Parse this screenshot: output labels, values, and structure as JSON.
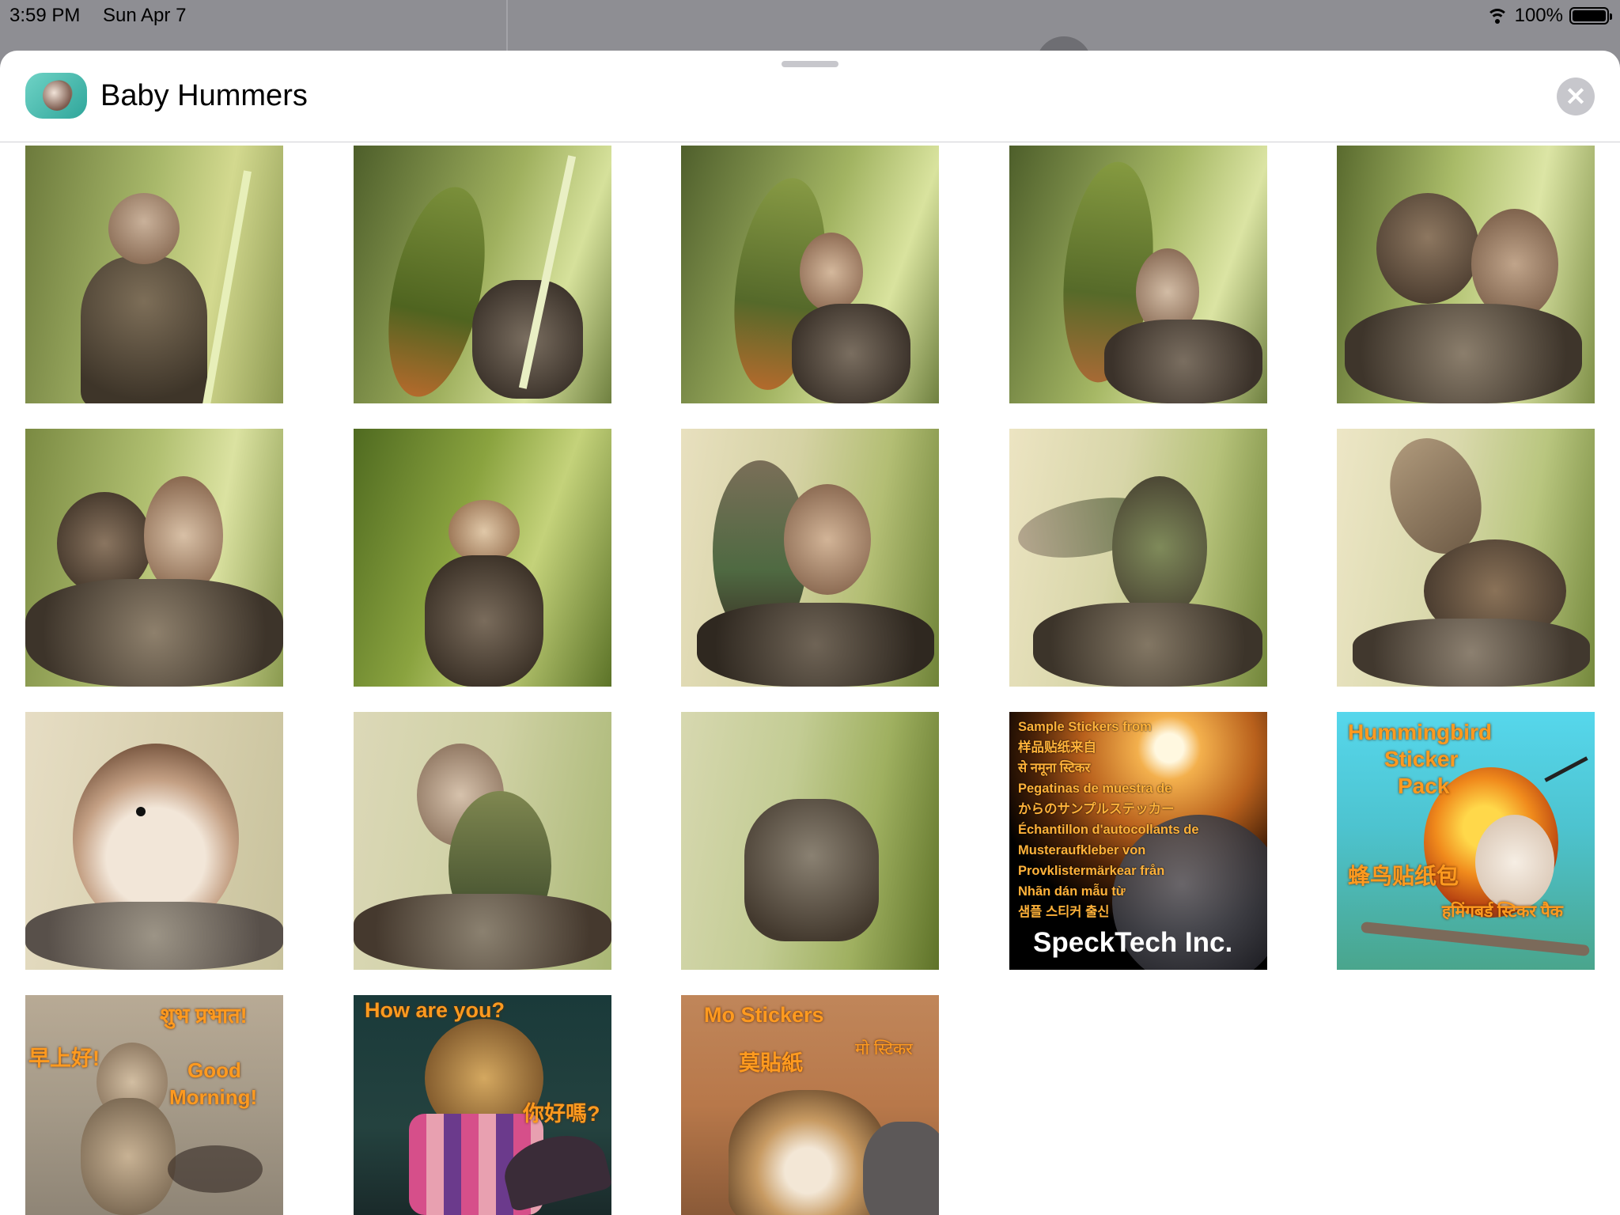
{
  "status_bar": {
    "time": "3:59 PM",
    "date": "Sun Apr 7",
    "battery": "100%"
  },
  "header": {
    "title": "Baby Hummers"
  },
  "colors": {
    "sheet_bg": "#ffffff",
    "status_bg": "#8e8e93",
    "close_bg": "#c7c7cc",
    "sticker_text": "#ff9a1f"
  },
  "stickers": [
    {
      "label": "hummingbird-nestling-photo"
    },
    {
      "label": "hummingbird-feeding-photo"
    },
    {
      "label": "hummingbird-feeding-photo"
    },
    {
      "label": "hummingbird-feeding-photo"
    },
    {
      "label": "hummingbird-nestlings-photo"
    },
    {
      "label": "hummingbird-nestlings-photo"
    },
    {
      "label": "hummingbird-nest-photo"
    },
    {
      "label": "hummingbird-fledglings-photo"
    },
    {
      "label": "hummingbird-wings-photo"
    },
    {
      "label": "hummingbird-wings-photo"
    },
    {
      "label": "hummingbird-closeup-photo"
    },
    {
      "label": "hummingbird-closeup-photo"
    },
    {
      "label": "empty-nest-photo"
    }
  ],
  "specktech_sticker": {
    "lines": [
      "Sample Stickers from",
      "样品贴纸来自",
      "से नमूना स्टिकर",
      "Pegatinas de muestra de",
      "からのサンプルステッカー",
      "Échantillon d'autocollants de",
      "Musteraufkleber von",
      "Provklistermärkear från",
      "Nhãn dán mẫu từ",
      "샘플 스티커 출신"
    ],
    "brand": "SpeckTech Inc."
  },
  "pack_sticker": {
    "line1": "Hummingbird",
    "line2": "Sticker",
    "line3": "Pack",
    "chinese": "蜂鸟贴纸包",
    "hindi": "हमिंगबर्ड स्टिकर पैक"
  },
  "morning_sticker": {
    "hindi": "शुभ प्रभात!",
    "chinese": "早上好!",
    "english_1": "Good",
    "english_2": "Morning!"
  },
  "howareyou_sticker": {
    "english": "How are you?",
    "chinese": "你好嗎?"
  },
  "mostickers_sticker": {
    "english": "Mo Stickers",
    "chinese": "莫貼紙",
    "hindi": "मो स्टिकर"
  }
}
